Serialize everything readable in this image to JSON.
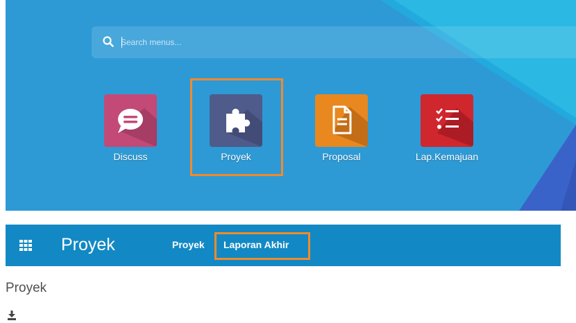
{
  "search": {
    "placeholder": "Search menus..."
  },
  "apps": [
    {
      "label": "Discuss",
      "icon": "speech-bubble-icon",
      "color": "#c34a76"
    },
    {
      "label": "Proyek",
      "icon": "puzzle-icon",
      "color": "#4f5b8a"
    },
    {
      "label": "Proposal",
      "icon": "document-icon",
      "color": "#e8881f"
    },
    {
      "label": "Lap.Kemajuan",
      "icon": "checklist-icon",
      "color": "#d0262e"
    }
  ],
  "navbar": {
    "title": "Proyek",
    "menu": [
      {
        "label": "Proyek"
      },
      {
        "label": "Laporan Akhir"
      }
    ]
  },
  "page": {
    "title": "Proyek"
  },
  "icons": {
    "apps": "grid-icon",
    "download": "download-icon"
  },
  "colors": {
    "background_blue": "#2d9ad6",
    "navbar": "#1289c4",
    "highlight": "#f28a2c"
  }
}
